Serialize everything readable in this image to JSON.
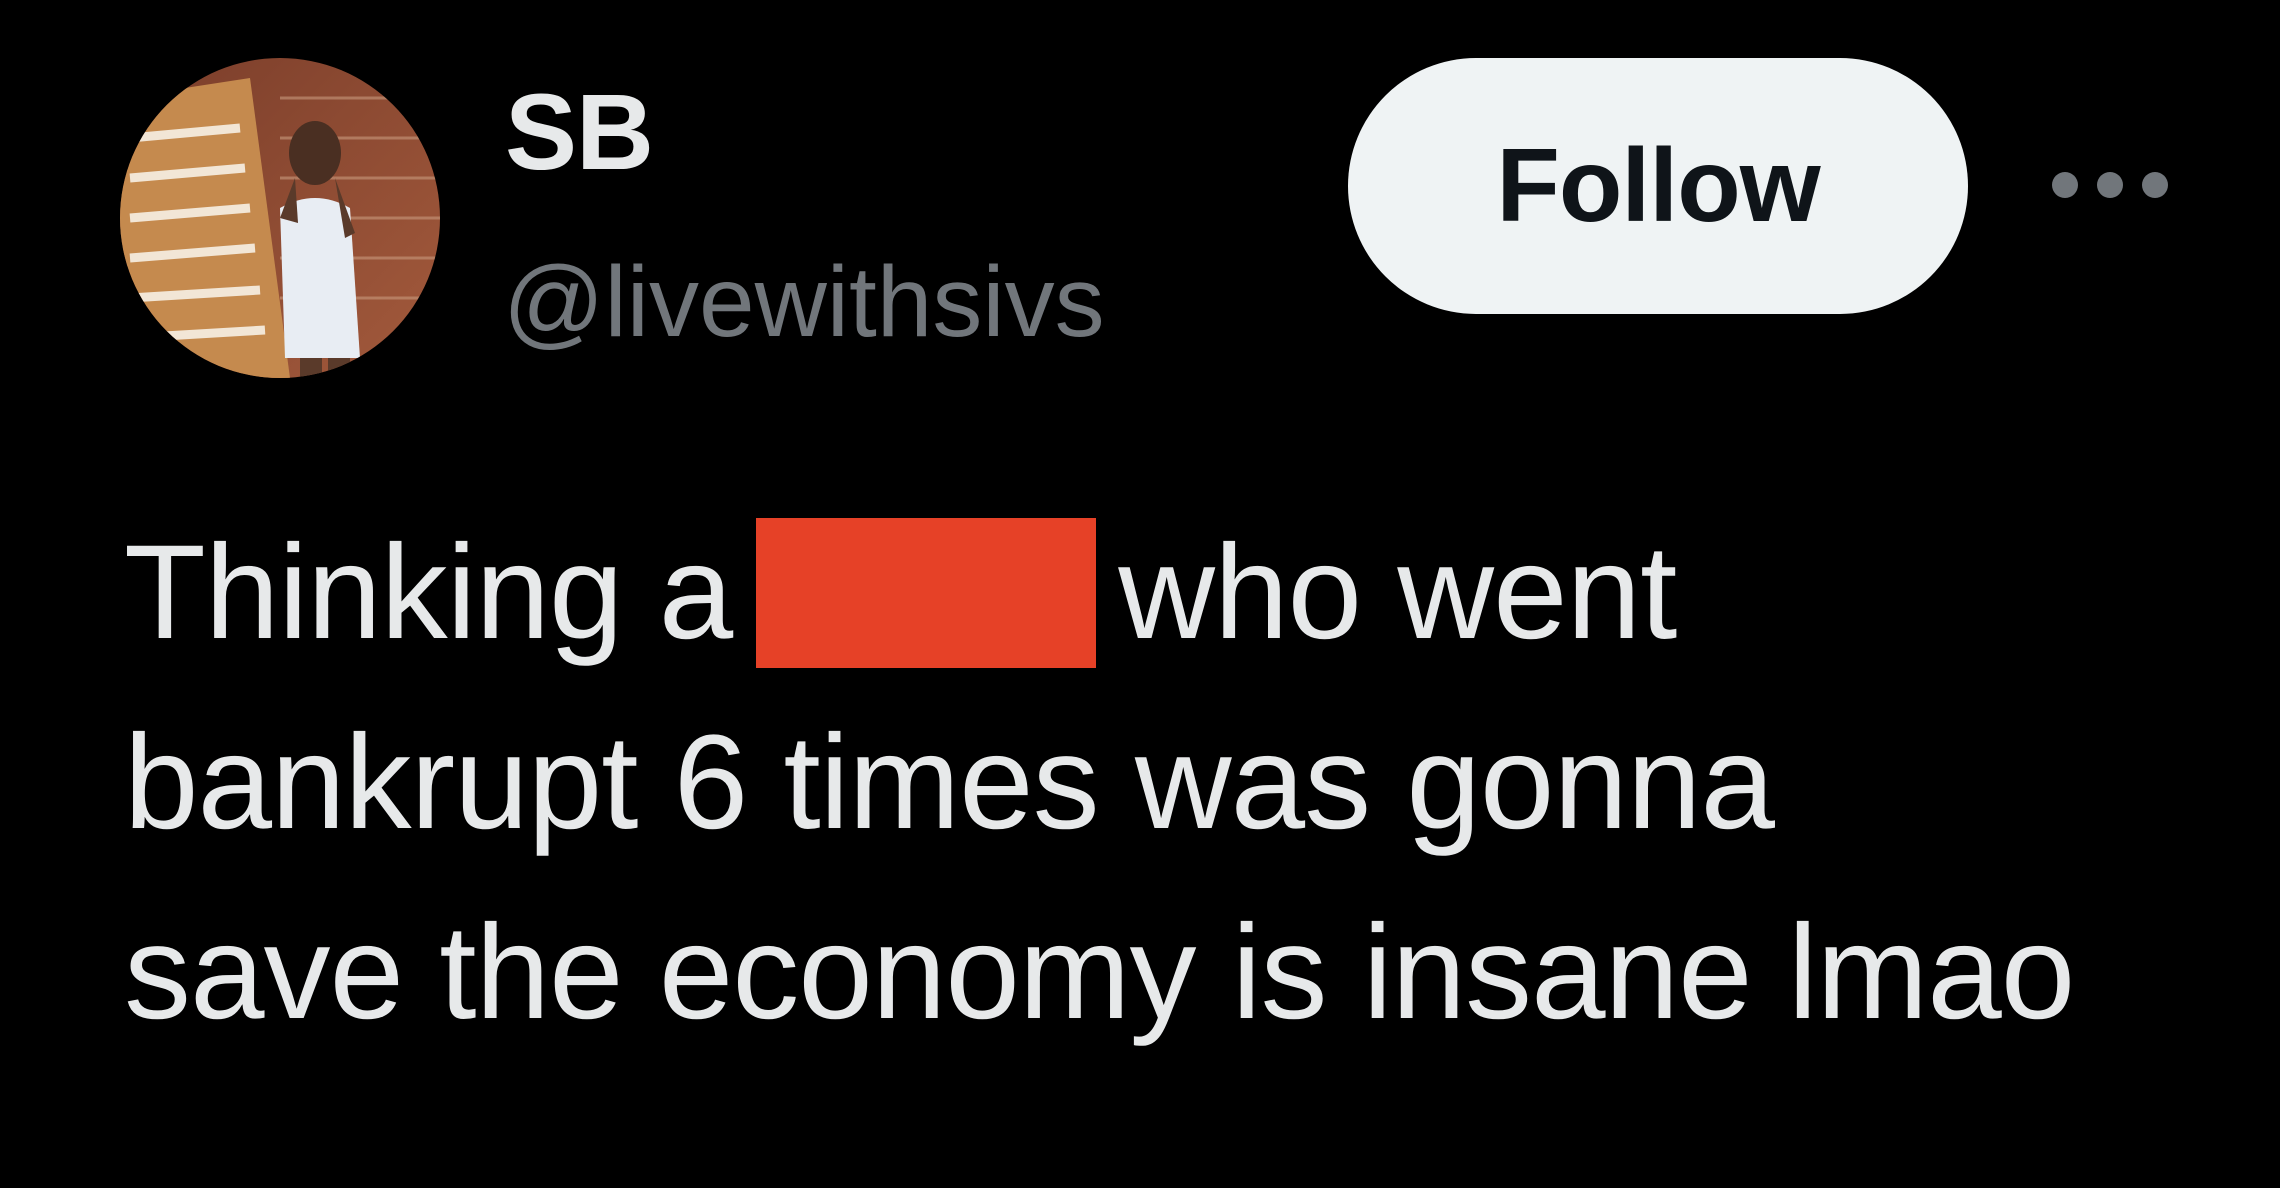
{
  "author": {
    "display_name": "SB",
    "handle": "@livewithsivs",
    "avatar_icon": "profile-photo-icon"
  },
  "actions": {
    "follow_label": "Follow",
    "more_icon": "more-horizontal-icon"
  },
  "tweet": {
    "line1_before": "Thinking a",
    "line1_after": "who went",
    "line2": "bankrupt 6 times was gonna",
    "line3": "save the economy is insane lmao",
    "redaction_color": "#e64127"
  },
  "colors": {
    "background": "#000000",
    "text_primary": "#e7e9ea",
    "text_secondary": "#71767b",
    "follow_bg": "#eff3f4"
  }
}
